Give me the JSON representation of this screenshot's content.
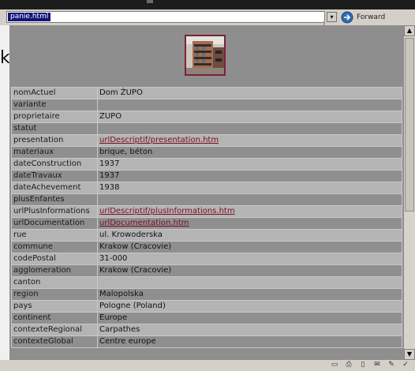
{
  "address_bar": {
    "url": "panie.html",
    "forward_label": "Forward"
  },
  "gutter_letter": "k",
  "record": [
    {
      "key": "nomActuel",
      "value": "Dom ŻUPO",
      "link": false
    },
    {
      "key": "variante",
      "value": "",
      "link": false
    },
    {
      "key": "proprietaire",
      "value": "ZUPO",
      "link": false
    },
    {
      "key": "statut",
      "value": "",
      "link": false
    },
    {
      "key": "presentation",
      "value": "urlDescriptif/presentation.htm",
      "link": true
    },
    {
      "key": "materiaux",
      "value": "brique, béton",
      "link": false
    },
    {
      "key": "dateConstruction",
      "value": "1937",
      "link": false
    },
    {
      "key": "dateTravaux",
      "value": "1937",
      "link": false
    },
    {
      "key": "dateAchevement",
      "value": "1938",
      "link": false
    },
    {
      "key": "plusEnfantes",
      "value": "",
      "link": false
    },
    {
      "key": "urlPlusInformations",
      "value": "urlDescriptif/plusInformations.htm",
      "link": true
    },
    {
      "key": "urlDocumentation",
      "value": "urlDocumentation.htm",
      "link": true
    },
    {
      "key": "rue",
      "value": "ul. Krowoderska",
      "link": false
    },
    {
      "key": "commune",
      "value": "Krakow (Cracovie)",
      "link": false
    },
    {
      "key": "codePostal",
      "value": "31-000",
      "link": false
    },
    {
      "key": "agglomeration",
      "value": "Krakow (Cracovie)",
      "link": false
    },
    {
      "key": "canton",
      "value": "",
      "link": false
    },
    {
      "key": "region",
      "value": "Malopolska",
      "link": false
    },
    {
      "key": "pays",
      "value": "Pologne (Poland)",
      "link": false
    },
    {
      "key": "continent",
      "value": "Europe",
      "link": false
    },
    {
      "key": "contexteRegional",
      "value": "Carpathes",
      "link": false
    },
    {
      "key": "contexteGlobal",
      "value": "Centre europe",
      "link": false
    }
  ],
  "status_icons": [
    "save-icon",
    "print-icon",
    "page-icon",
    "mail-icon",
    "edit-icon",
    "check-icon"
  ],
  "colors": {
    "link": "#7a0e20",
    "row_light": "#b4b4b4",
    "row_dark": "#8f8f8f",
    "selection": "#14147a"
  }
}
